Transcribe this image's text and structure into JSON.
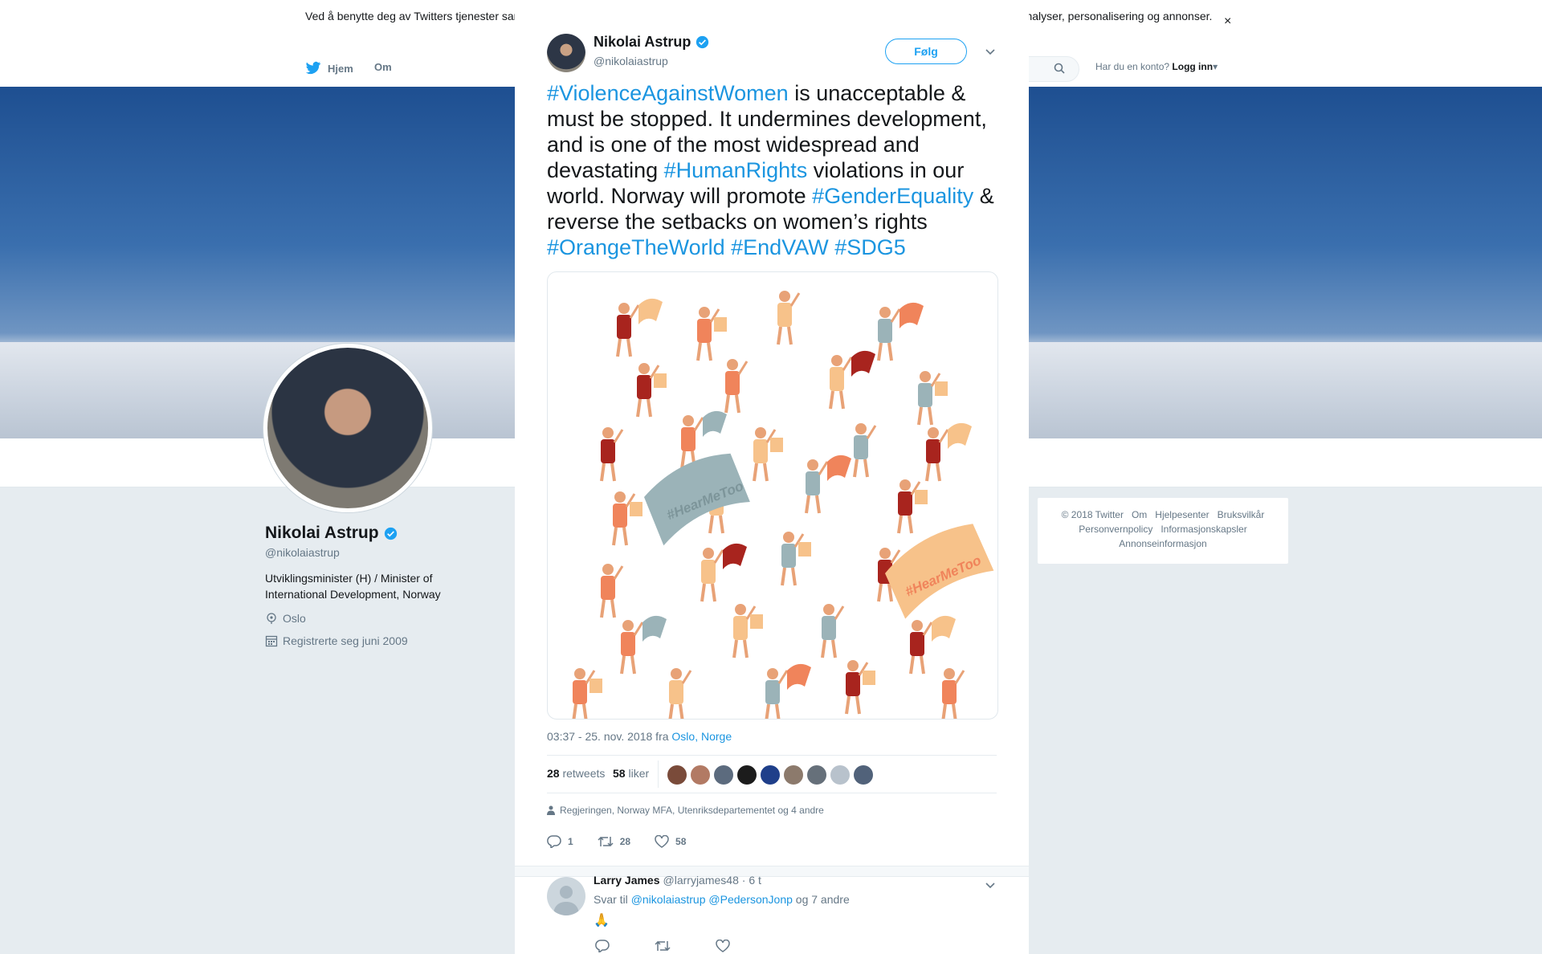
{
  "cookie": {
    "text": "Ved å benytte deg av Twitters tjenester samtykker du til vår bruk av informasjonskapsler. Vi og våre partnere bruker informasjonskapsler til bl.a. analyser, personalisering og annonser.",
    "close": "×"
  },
  "nav": {
    "home": "Hjem",
    "about": "Om",
    "login_prompt": "Har du en konto?",
    "login_link": "Logg inn"
  },
  "profile": {
    "name": "Nikolai Astrup",
    "handle": "@nikolaiastrup",
    "bio": "Utviklingsminister (H) / Minister of International Development, Norway",
    "location": "Oslo",
    "joined": "Registrerte seg juni 2009"
  },
  "footer": {
    "line1": [
      "© 2018 Twitter",
      "Om",
      "Hjelpesenter",
      "Bruksvilkår"
    ],
    "line2": [
      "Personvernpolicy",
      "Informasjonskapsler"
    ],
    "line3": [
      "Annonseinformasjon"
    ]
  },
  "overlay_close": "×",
  "tweet": {
    "author_name": "Nikolai Astrup",
    "author_handle": "@nikolaiastrup",
    "follow_label": "Følg",
    "text_parts": [
      {
        "t": "#ViolenceAgainstWomen",
        "tag": true
      },
      {
        "t": " is unacceptable & must be stopped. It undermines development, and is one of the most widespread and devastating ",
        "tag": false
      },
      {
        "t": "#HumanRights",
        "tag": true
      },
      {
        "t": " violations in our world. Norway will promote ",
        "tag": false
      },
      {
        "t": "#GenderEquality",
        "tag": true
      },
      {
        "t": " & reverse the setbacks on women’s rights ",
        "tag": false
      },
      {
        "t": "#OrangeTheWorld",
        "tag": true
      },
      {
        "t": " ",
        "tag": false
      },
      {
        "t": "#EndVAW",
        "tag": true
      },
      {
        "t": " ",
        "tag": false
      },
      {
        "t": "#SDG5",
        "tag": true
      }
    ],
    "media_banner_text": "#HearMeToo",
    "timestamp": "03:37 - 25. nov. 2018 fra ",
    "place": "Oslo, Norge",
    "retweets_count": "28",
    "retweets_label": "retweets",
    "likes_count": "58",
    "likes_label": "liker",
    "liker_colors": [
      "#7a4b3a",
      "#b27a64",
      "#5c6b7e",
      "#1c1c1c",
      "#1f3f8a",
      "#8c7a6c",
      "#66707a",
      "#b8c2cc",
      "#51627a"
    ],
    "liked_by": "Regjeringen, Norway MFA, Utenriksdepartementet og 4 andre",
    "reply_count": "1",
    "retweet_count": "28",
    "like_count": "58"
  },
  "reply": {
    "name": "Larry James",
    "handle": "@larryjames48",
    "time": "· 6 t",
    "reply_to_label": "Svar til",
    "mention1": "@nikolaiastrup",
    "mention2": "@PedersonJonp",
    "others": "og 7 andre",
    "emoji": "🙏"
  },
  "colors": {
    "accent": "#1da1f2",
    "hashtag": "#1b95e0",
    "verified": "#1da1f2",
    "illustration_dark": "#a8241e",
    "illustration_orange": "#f0845b",
    "illustration_light": "#f7c28a",
    "illustration_blue": "#9bb3b8"
  }
}
